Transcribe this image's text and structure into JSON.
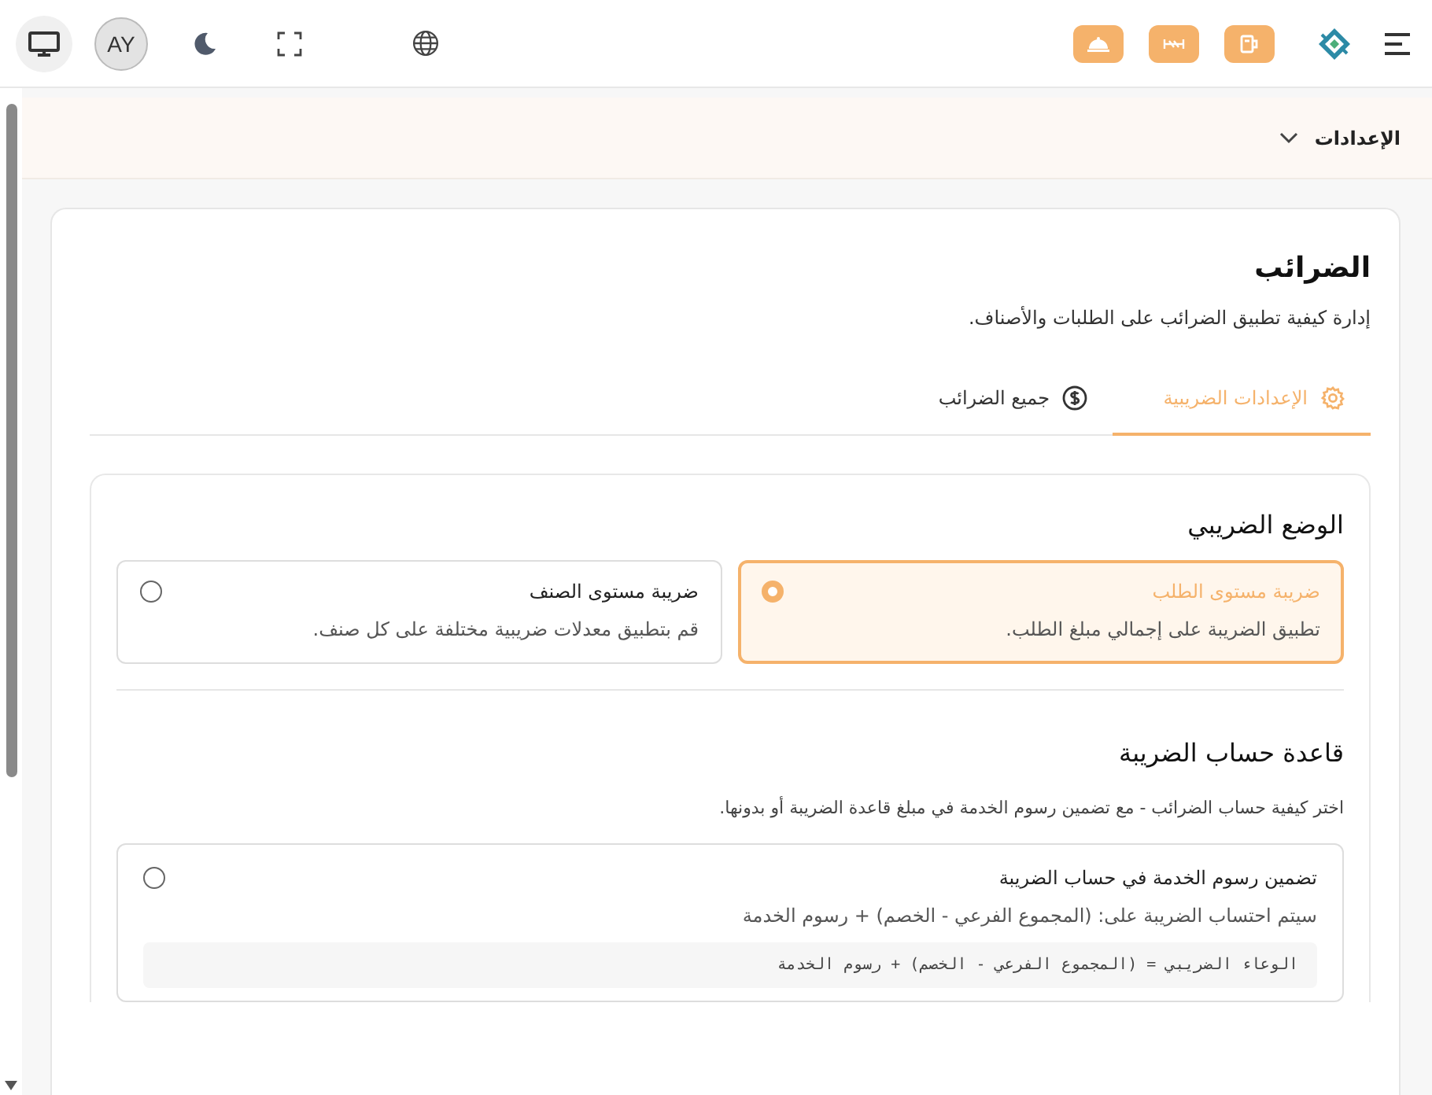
{
  "topbar": {
    "avatar": "AY"
  },
  "section": {
    "title": "الإعدادات",
    "expanded": true
  },
  "page": {
    "title": "الضرائب",
    "subtitle": "إدارة كيفية تطبيق الضرائب على الطلبات والأصناف."
  },
  "tabs": [
    {
      "label": "الإعدادات الضريبية",
      "kind": "settings",
      "selected": true
    },
    {
      "label": "جميع الضرائب",
      "kind": "currency",
      "selected": false
    }
  ],
  "tax_mode": {
    "heading": "الوضع الضريبي",
    "options": [
      {
        "title": "ضريبة مستوى الطلب",
        "description": "تطبيق الضريبة على إجمالي مبلغ الطلب.",
        "selected": true
      },
      {
        "title": "ضريبة مستوى الصنف",
        "description": "قم بتطبيق معدلات ضريبية مختلفة على كل صنف.",
        "selected": false
      }
    ]
  },
  "calculation_base": {
    "heading": "قاعدة حساب الضريبة",
    "description": "اختر كيفية حساب الضرائب - مع تضمين رسوم الخدمة في مبلغ قاعدة الضريبة أو بدونها.",
    "options": [
      {
        "title": "تضمين رسوم الخدمة في حساب الضريبة",
        "description": "سيتم احتساب الضريبة على: (المجموع الفرعي - الخصم) + رسوم الخدمة",
        "formula": "الوعاء الضريبي = (المجموع الفرعي - الخصم) + رسوم الخدمة",
        "selected": false
      }
    ]
  }
}
